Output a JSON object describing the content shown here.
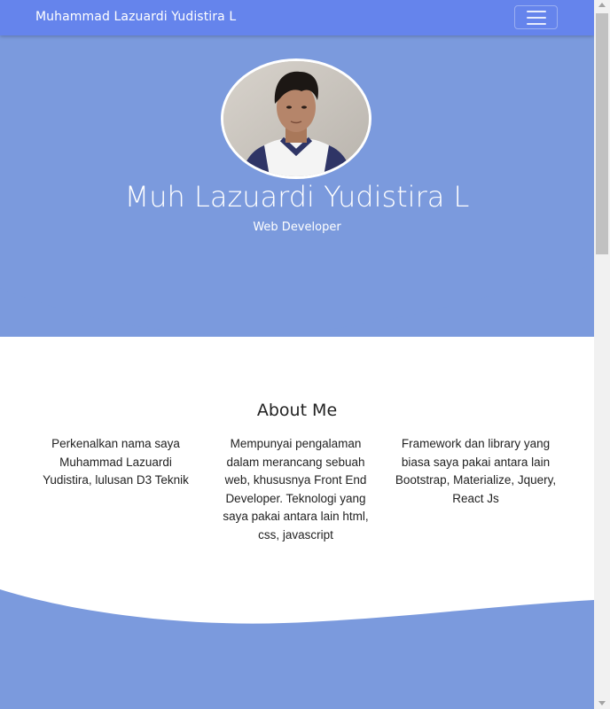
{
  "navbar": {
    "brand": "Muhammad Lazuardi Yudistira L",
    "toggle_icon": "hamburger-menu-icon"
  },
  "hero": {
    "name": "Muh Lazuardi Yudistira L",
    "role": "Web Developer",
    "avatar_icon": "profile-photo"
  },
  "about": {
    "title": "About Me",
    "columns": [
      "Perkenalkan nama saya Muhammad Lazuardi Yudistira, lulusan D3 Teknik",
      "Mempunyai pengalaman dalam merancang sebuah web, khususnya Front End Developer. Teknologi yang saya pakai antara lain html, css, javascript",
      "Framework dan library yang biasa saya pakai antara lain Bootstrap, Materialize, Jquery, React Js"
    ]
  },
  "colors": {
    "navbar": "#6584ec",
    "hero": "#7b9add",
    "text": "#222222",
    "white": "#ffffff"
  }
}
